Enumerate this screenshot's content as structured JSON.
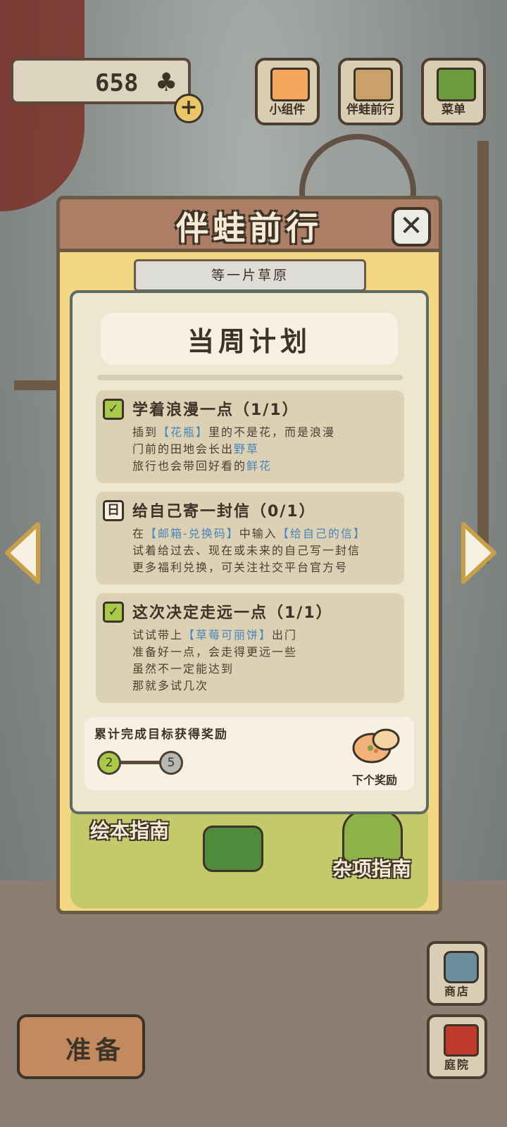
{
  "currency": {
    "amount": "658",
    "icon": "clover-icon"
  },
  "top_buttons": [
    {
      "label": "小组件",
      "icon": "widget-icon"
    },
    {
      "label": "伴蛙前行",
      "icon": "book-icon"
    },
    {
      "label": "菜单",
      "icon": "menu-icon"
    }
  ],
  "modal": {
    "title": "伴蛙前行",
    "banner": "等一片草原",
    "card_title": "当周计划",
    "tasks": [
      {
        "title": "学着浪漫一点（1/1）",
        "status": "done",
        "lines": [
          [
            {
              "t": "插到"
            },
            {
              "t": "【花瓶】",
              "hl": true
            },
            {
              "t": "里的不是花，而是浪漫"
            }
          ],
          [
            {
              "t": "门前的田地会长出"
            },
            {
              "t": "野草",
              "hl": true
            }
          ],
          [
            {
              "t": "旅行也会带回好看的"
            },
            {
              "t": "鲜花",
              "hl": true
            }
          ]
        ]
      },
      {
        "title": "给自己寄一封信（0/1）",
        "status": "pending",
        "lines": [
          [
            {
              "t": "在"
            },
            {
              "t": "【邮箱-兑换码】",
              "hl": true
            },
            {
              "t": "中输入"
            },
            {
              "t": "【给自己的信】",
              "hl": true
            }
          ],
          [
            {
              "t": "试着给过去、现在或未来的自己写一封信"
            }
          ],
          [
            {
              "t": "更多福利兑换，可关注社交平台官方号"
            }
          ]
        ]
      },
      {
        "title": "这次决定走远一点（1/1）",
        "status": "done",
        "lines": [
          [
            {
              "t": "试试带上"
            },
            {
              "t": "【草莓可丽饼】",
              "hl": true
            },
            {
              "t": "出门"
            }
          ],
          [
            {
              "t": "准备好一点，会走得更远一些"
            }
          ],
          [
            {
              "t": "虽然不一定能达到"
            }
          ],
          [
            {
              "t": "那就多试几次"
            }
          ]
        ]
      }
    ],
    "reward": {
      "label": "累计完成目标获得奖励",
      "current": "2",
      "target": "5",
      "next_label": "下个奖励"
    },
    "guides": {
      "left": "绘本指南",
      "right": "杂项指南"
    }
  },
  "bottom": {
    "prepare": "准备",
    "shop": "商店",
    "yard": "庭院"
  },
  "colors": {
    "highlight": "#4a84b8",
    "accent_green": "#a9c94a",
    "card_bg": "#ede6d0"
  }
}
